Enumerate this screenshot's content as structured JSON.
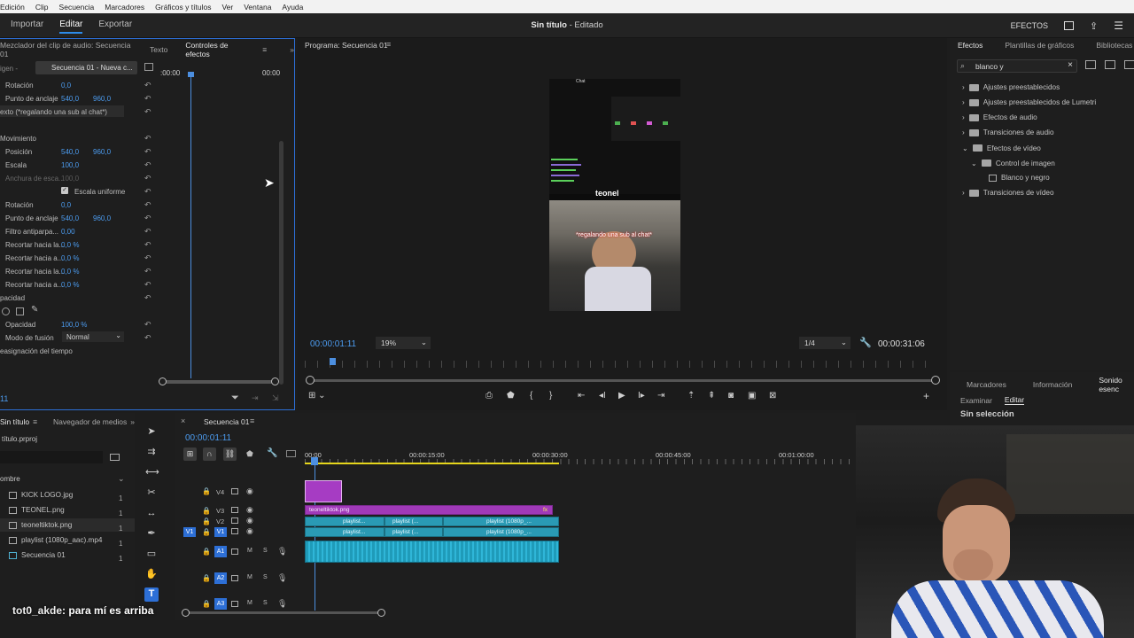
{
  "menu": [
    "Edición",
    "Clip",
    "Secuencia",
    "Marcadores",
    "Gráficos y títulos",
    "Ver",
    "Ventana",
    "Ayuda"
  ],
  "workspace": {
    "tabs": [
      "Importar",
      "Editar",
      "Exportar"
    ],
    "title_name": "Sin título",
    "title_state": " - Editado",
    "efectos_label": "EFECTOS"
  },
  "effect_controls": {
    "tabs": [
      "Mezclador del clip de audio: Secuencia 01",
      "Texto",
      "Controles de efectos"
    ],
    "source_label": "igen -",
    "sequence_label": "Secuencia 01 - Nueva c...",
    "timecode_start": ":00:00",
    "timecode_end": "00:00",
    "rows": [
      {
        "label": "Rotación",
        "v1": "0,0",
        "v2": ""
      },
      {
        "label": "Punto de anclaje",
        "v1": "540,0",
        "v2": "960,0"
      },
      {
        "label": "exto (*regalando una sub al chat*)",
        "v1": "",
        "v2": ""
      },
      {
        "label": "",
        "v1": "",
        "v2": ""
      },
      {
        "label": "Movimiento",
        "v1": "",
        "v2": ""
      },
      {
        "label": "Posición",
        "v1": "540,0",
        "v2": "960,0"
      },
      {
        "label": "Escala",
        "v1": "100,0",
        "v2": ""
      },
      {
        "label": "Anchura de esca...",
        "v1": "100,0",
        "v2": ""
      },
      {
        "label": "Escala uniforme",
        "v1": "",
        "v2": ""
      },
      {
        "label": "Rotación",
        "v1": "0,0",
        "v2": ""
      },
      {
        "label": "Punto de anclaje",
        "v1": "540,0",
        "v2": "960,0"
      },
      {
        "label": "Filtro antiparpa...",
        "v1": "0,00",
        "v2": ""
      },
      {
        "label": "Recortar hacia la...",
        "v1": "0,0 %",
        "v2": ""
      },
      {
        "label": "Recortar hacia a...",
        "v1": "0,0 %",
        "v2": ""
      },
      {
        "label": "Recortar hacia la...",
        "v1": "0,0 %",
        "v2": ""
      },
      {
        "label": "Recortar hacia a...",
        "v1": "0,0 %",
        "v2": ""
      },
      {
        "label": "pacidad",
        "v1": "",
        "v2": ""
      },
      {
        "label": "",
        "v1": "",
        "v2": ""
      },
      {
        "label": "Opacidad",
        "v1": "100,0 %",
        "v2": ""
      },
      {
        "label": "Modo de fusión",
        "v1": "Normal",
        "v2": ""
      },
      {
        "label": "easignación del tiempo",
        "v1": "",
        "v2": ""
      }
    ],
    "footer_time": "11"
  },
  "program": {
    "tab": "Programa: Secuencia 01",
    "timecode": "00:00:01:11",
    "zoom": "19%",
    "quality": "1/4",
    "duration": "00:00:31:06",
    "overlay_logo": "teonel",
    "overlay_caption": "*regalando una sub al chat*",
    "overlay_chat_title": "Chat"
  },
  "effects": {
    "tabs": [
      "Efectos",
      "Plantillas de gráficos",
      "Bibliotecas"
    ],
    "search_value": "blanco y",
    "tree": [
      {
        "label": "Ajustes preestablecidos",
        "level": 0,
        "expanded": false
      },
      {
        "label": "Ajustes preestablecidos de Lumetri",
        "level": 0,
        "expanded": false
      },
      {
        "label": "Efectos de audio",
        "level": 0,
        "expanded": false
      },
      {
        "label": "Transiciones de audio",
        "level": 0,
        "expanded": false
      },
      {
        "label": "Efectos de vídeo",
        "level": 0,
        "expanded": true
      },
      {
        "label": "Control de imagen",
        "level": 1,
        "expanded": true
      },
      {
        "label": "Blanco y negro",
        "level": 2,
        "expanded": false
      },
      {
        "label": "Transiciones de vídeo",
        "level": 0,
        "expanded": false
      }
    ]
  },
  "info": {
    "tabs": [
      "Marcadores",
      "Información",
      "Sonido esenc"
    ],
    "subtabs": [
      "Examinar",
      "Editar"
    ],
    "status": "Sin selección"
  },
  "project": {
    "tabs": [
      "Sin título",
      "Navegador de medios"
    ],
    "file": "título.prproj",
    "column": "ombre",
    "items": [
      "KICK LOGO.jpg",
      "TEONEL.png",
      "teoneltiktok.png",
      "playlist (1080p_aac).mp4",
      "Secuencia 01"
    ]
  },
  "timeline": {
    "tab": "Secuencia 01",
    "timecode": "00:00:01:11",
    "ruler": [
      "00:00",
      "00:00:15:00",
      "00:00:30:00",
      "00:00:45:00",
      "00:01:00:00"
    ],
    "tracks": [
      "V4",
      "V3",
      "V2",
      "V1",
      "A1",
      "A2",
      "A3"
    ],
    "clips": {
      "v3": "teoneltiktok.png",
      "v2a": "playlist...",
      "v2b": "playlist (...",
      "v2c": "playlist (1080p_...",
      "v1a": "playlist...",
      "v1b": "playlist (...",
      "v1c": "playlist (1080p_..."
    }
  },
  "chat_overlay": {
    "user": "tot0_akde",
    "message": ": para mí es arriba"
  }
}
